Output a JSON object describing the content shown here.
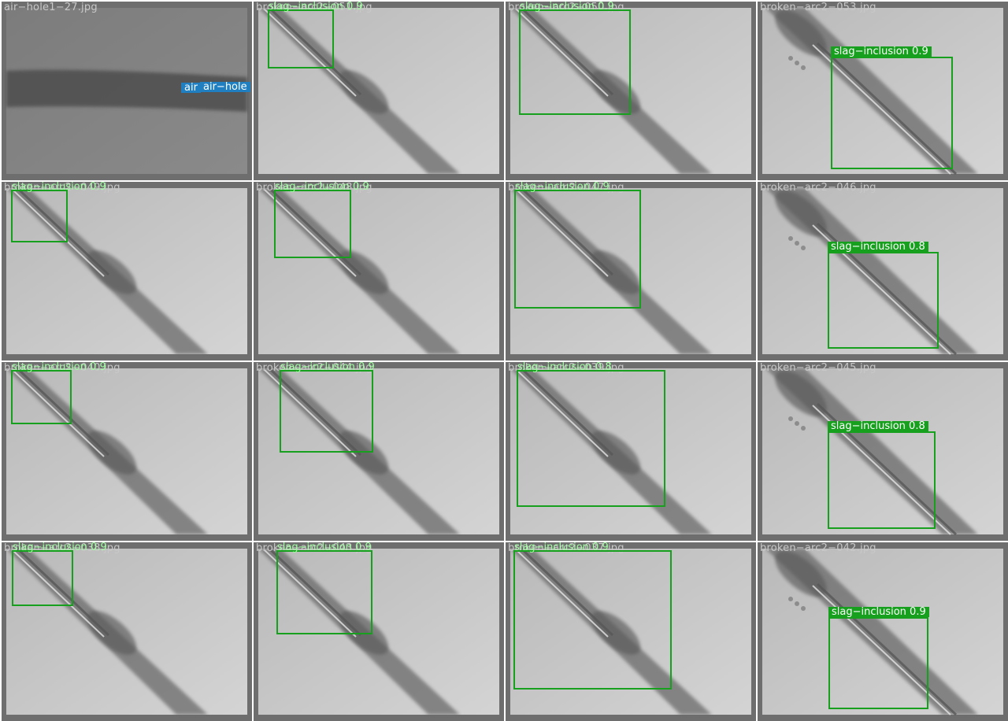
{
  "grid": {
    "columns": 4,
    "rows": 4
  },
  "colors": {
    "frame": "#6e6e6e",
    "separator": "#ffffff",
    "slag_inclusion_box": "#17a01e",
    "air_hole_label": "#1f7fc0",
    "filename_text": "#c8c8c8"
  },
  "tiles": [
    {
      "filename": "air−hole1−27.jpg",
      "scene": "horizontal-weld",
      "detections": [
        {
          "class": "air",
          "label": "air",
          "air": true
        },
        {
          "class": "air-hole",
          "label": "air−hole",
          "air": true
        }
      ]
    },
    {
      "filename": "broken−arc2−051.jpg",
      "scene": "diagonal",
      "detections": [
        {
          "class": "slag-inclusion",
          "label": "slag−inclusion 0.9"
        }
      ]
    },
    {
      "filename": "broken−arc2−050.jpg",
      "scene": "diagonal",
      "detections": [
        {
          "class": "slag-inclusion",
          "label": "slag−inclusion 0.9"
        }
      ]
    },
    {
      "filename": "broken−arc2−053.jpg",
      "scene": "diagonal-right",
      "detections": [
        {
          "class": "slag-inclusion",
          "label": "slag−inclusion 0.9"
        }
      ]
    },
    {
      "filename": "broken−arc2−049.jpg",
      "scene": "diagonal",
      "detections": [
        {
          "class": "slag-inclusion",
          "label": "slag−inclusion 0.9"
        }
      ]
    },
    {
      "filename": "broken−arc2−048.jpg",
      "scene": "diagonal",
      "detections": [
        {
          "class": "slag-inclusion",
          "label": "slag−inclusion 0.9"
        }
      ]
    },
    {
      "filename": "broken−arc2−047.jpg",
      "scene": "diagonal",
      "detections": [
        {
          "class": "slag-inclusion",
          "label": "slag−inclusion 0.9"
        }
      ]
    },
    {
      "filename": "broken−arc2−046.jpg",
      "scene": "diagonal-right",
      "detections": [
        {
          "class": "slag-inclusion",
          "label": "slag−inclusion 0.8"
        }
      ]
    },
    {
      "filename": "broken−arc2−040.jpg",
      "scene": "diagonal",
      "detections": [
        {
          "class": "slag-inclusion",
          "label": "slag−inclusion 0.9"
        }
      ]
    },
    {
      "filename": "broken−arc2−044.jpg",
      "scene": "diagonal",
      "detections": [
        {
          "class": "slag-inclusion",
          "label": "slag−inclusion 0.9"
        }
      ]
    },
    {
      "filename": "broken−arc2−039.jpg",
      "scene": "diagonal",
      "detections": [
        {
          "class": "slag-inclusion",
          "label": "slag−inclusion 0.8"
        }
      ]
    },
    {
      "filename": "broken−arc2−045.jpg",
      "scene": "diagonal-right",
      "detections": [
        {
          "class": "slag-inclusion",
          "label": "slag−inclusion 0.8"
        }
      ]
    },
    {
      "filename": "broken−arc2−038.jpg",
      "scene": "diagonal",
      "detections": [
        {
          "class": "slag-inclusion",
          "label": "slag−inclusion 0.9"
        }
      ]
    },
    {
      "filename": "broken−arc2−043.jpg",
      "scene": "diagonal",
      "detections": [
        {
          "class": "slag-inclusion",
          "label": "slag−inclusion 0.9"
        }
      ]
    },
    {
      "filename": "broken−arc2−037.jpg",
      "scene": "diagonal",
      "detections": [
        {
          "class": "slag-inclusion",
          "label": "slag−inclusion 0.9"
        }
      ]
    },
    {
      "filename": "broken−arc2−042.jpg",
      "scene": "diagonal-right",
      "detections": [
        {
          "class": "slag-inclusion",
          "label": "slag−inclusion 0.9"
        }
      ]
    }
  ]
}
